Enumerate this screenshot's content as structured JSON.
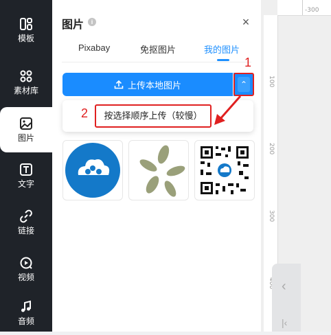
{
  "sidebar": {
    "items": [
      {
        "label": "模板",
        "icon": "template-icon"
      },
      {
        "label": "素材库",
        "icon": "material-library-icon"
      },
      {
        "label": "图片",
        "icon": "image-icon"
      },
      {
        "label": "文字",
        "icon": "text-icon"
      },
      {
        "label": "链接",
        "icon": "link-icon"
      },
      {
        "label": "视频",
        "icon": "video-icon"
      },
      {
        "label": "音频",
        "icon": "audio-icon"
      }
    ]
  },
  "panel": {
    "title": "图片",
    "info": "i",
    "close": "×",
    "tabs": [
      {
        "label": "Pixabay"
      },
      {
        "label": "免抠图片"
      },
      {
        "label": "我的图片"
      }
    ],
    "upload_label": "上传本地图片",
    "arrow_label": "⌃",
    "dropdown_item": "按选择顺序上传（较慢）"
  },
  "annotations": {
    "one": "1",
    "two": "2"
  },
  "ruler": {
    "h_label": "-300",
    "v_labels": [
      "100",
      "200",
      "300",
      "400"
    ]
  },
  "colors": {
    "accent": "#1a8cff",
    "annotation": "#e02020",
    "sidebar": "#1f2329"
  }
}
